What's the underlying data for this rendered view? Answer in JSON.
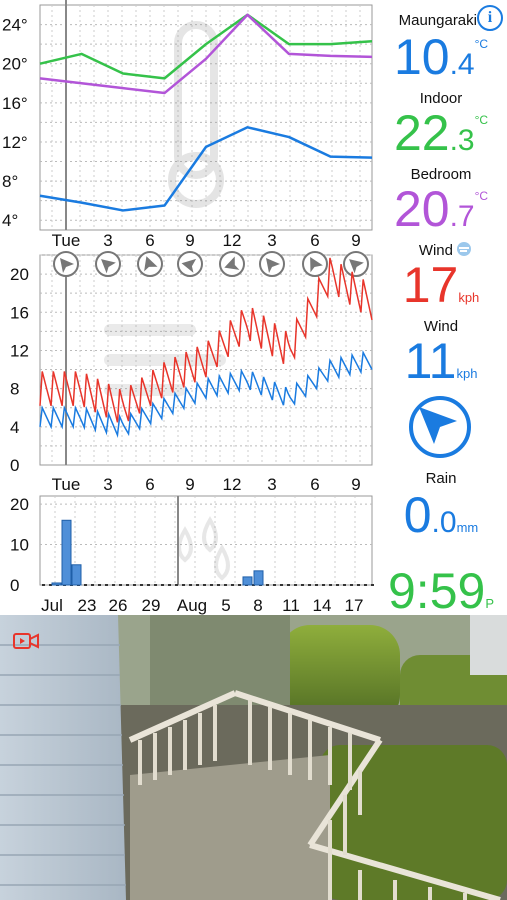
{
  "colors": {
    "outdoor": "#2aa3e8",
    "outdoor_temp": "#1a7be0",
    "indoor": "#35c24a",
    "bedroom": "#b255d8",
    "wind_gust": "#e8352b",
    "wind": "#1a7be0",
    "rain": "#1a7be0",
    "clock": "#35c24a"
  },
  "temp_chart": {
    "y_ticks": [
      "24°",
      "20°",
      "16°",
      "12°",
      "8°",
      "4°"
    ],
    "x_ticks": [
      "Tue",
      "3",
      "6",
      "9",
      "12",
      "3",
      "6",
      "9"
    ]
  },
  "wind_chart": {
    "y_ticks": [
      "20",
      "16",
      "12",
      "8",
      "4",
      "0"
    ],
    "x_ticks": [
      "Tue",
      "3",
      "6",
      "9",
      "12",
      "3",
      "6",
      "9"
    ],
    "direction_icons": [
      "wind-direction-icon",
      "wind-direction-icon",
      "wind-direction-icon",
      "wind-direction-icon",
      "wind-direction-icon",
      "wind-direction-icon",
      "wind-direction-icon",
      "wind-direction-icon"
    ]
  },
  "rain_chart": {
    "y_ticks": [
      "20",
      "10",
      "0"
    ],
    "x_ticks": [
      "Jul",
      "23",
      "26",
      "29",
      "Aug",
      "5",
      "8",
      "11",
      "14",
      "17"
    ]
  },
  "panel": {
    "station_name": "Maungaraki",
    "outdoor_whole": "10",
    "outdoor_dec": ".4",
    "outdoor_unit": "°C",
    "indoor_label": "Indoor",
    "indoor_whole": "22",
    "indoor_dec": ".3",
    "indoor_unit": "°C",
    "bedroom_label": "Bedroom",
    "bedroom_whole": "20",
    "bedroom_dec": ".7",
    "bedroom_unit": "°C",
    "gust_label": "Wind",
    "gust_value": "17",
    "gust_unit": "kph",
    "wind_label": "Wind",
    "wind_value": "11",
    "wind_unit": "kph",
    "rain_label": "Rain",
    "rain_whole": "0",
    "rain_dec": ".0",
    "rain_unit": "mm",
    "clock_time": "9:59",
    "clock_suffix": "P",
    "info_glyph": "i"
  },
  "camera": {
    "icon": "video-camera-icon"
  },
  "chart_data": [
    {
      "type": "line",
      "x": [
        "Tue 0h",
        "3",
        "6",
        "9",
        "12",
        "3",
        "6",
        "9",
        "10"
      ],
      "series": [
        {
          "values": [
            6.5,
            5.8,
            5.0,
            5.5,
            11.5,
            13.5,
            12.5,
            10.5,
            10.4
          ]
        },
        {
          "values": [
            20,
            21,
            19,
            18.5,
            22,
            25,
            22,
            22,
            22.3
          ]
        },
        {
          "values": [
            18.5,
            18,
            17.5,
            17,
            20.5,
            25,
            21,
            20.8,
            20.7
          ]
        }
      ],
      "ylim": [
        3,
        26
      ]
    },
    {
      "type": "line",
      "x": [
        "Tue 0h",
        "3",
        "6",
        "9",
        "12",
        "3",
        "6",
        "9",
        "10"
      ],
      "series": [
        {
          "values": [
            8,
            8,
            6,
            9,
            11,
            15,
            12,
            20,
            17
          ]
        },
        {
          "values": [
            5,
            5,
            4,
            6,
            8,
            9,
            7,
            10,
            11
          ]
        }
      ],
      "ylim": [
        0,
        22
      ]
    },
    {
      "type": "bar",
      "categories": [
        "Jul 20",
        "Jul 21",
        "Jul 22",
        "Aug 7",
        "Aug 8"
      ],
      "values": [
        0.5,
        16,
        5,
        2,
        3.5
      ],
      "ylim": [
        0,
        22
      ]
    }
  ]
}
